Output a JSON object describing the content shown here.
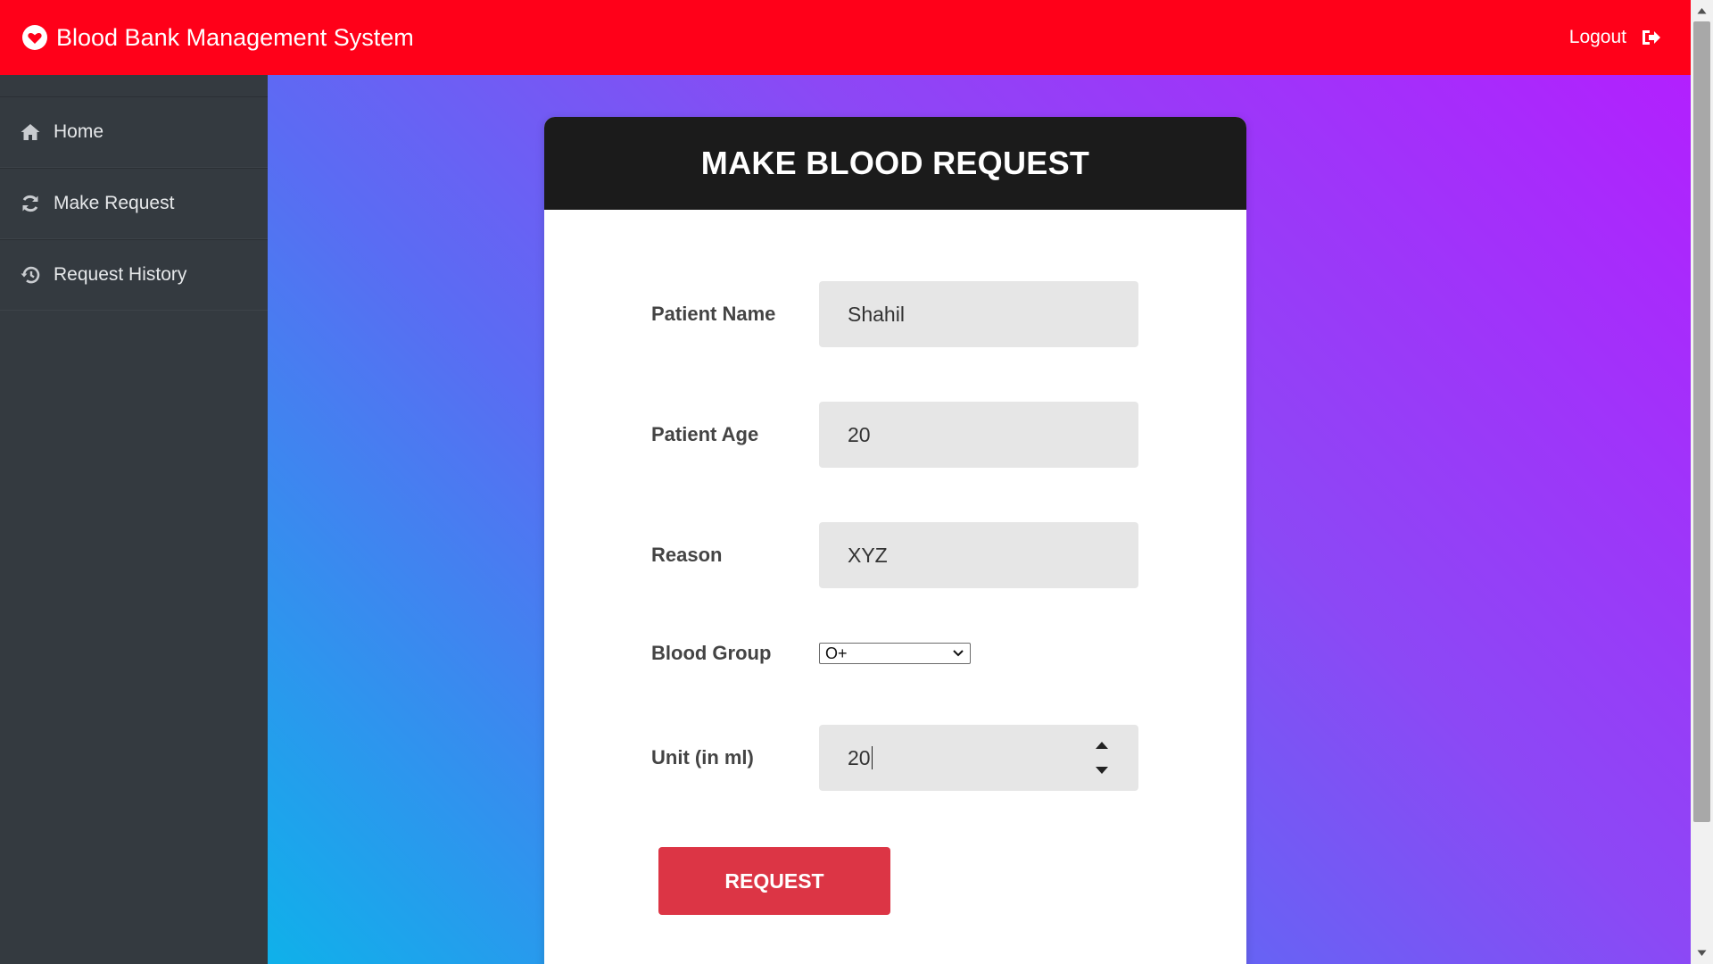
{
  "app": {
    "title": "Blood Bank Management System",
    "logout_label": "Logout",
    "accent_color": "#ff0019"
  },
  "sidebar": {
    "items": [
      {
        "label": "Home",
        "icon": "home-icon"
      },
      {
        "label": "Make Request",
        "icon": "refresh-icon"
      },
      {
        "label": "Request History",
        "icon": "history-icon"
      }
    ]
  },
  "form": {
    "heading": "MAKE BLOOD REQUEST",
    "patient_name": {
      "label": "Patient Name",
      "value": "Shahil"
    },
    "patient_age": {
      "label": "Patient Age",
      "value": "20"
    },
    "reason": {
      "label": "Reason",
      "value": "XYZ"
    },
    "blood_group": {
      "label": "Blood Group",
      "value": "O+"
    },
    "unit": {
      "label": "Unit (in ml)",
      "value": "20"
    },
    "submit_label": "REQUEST",
    "submit_color": "#dc3545"
  }
}
